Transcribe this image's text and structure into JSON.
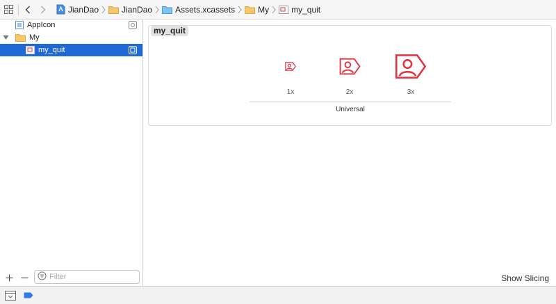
{
  "jumpbar": {
    "crumbs": [
      {
        "label": "JianDao",
        "icon": "project-file-icon"
      },
      {
        "label": "JianDao",
        "icon": "folder-icon"
      },
      {
        "label": "Assets.xcassets",
        "icon": "asset-catalog-icon"
      },
      {
        "label": "My",
        "icon": "folder-icon"
      },
      {
        "label": "my_quit",
        "icon": "image-set-icon"
      }
    ]
  },
  "sidebar": {
    "items": [
      {
        "label": "AppIcon",
        "icon": "appicon-icon"
      },
      {
        "label": "My",
        "icon": "folder-icon"
      },
      {
        "label": "my_quit",
        "icon": "image-set-icon"
      }
    ],
    "filter_placeholder": "Filter"
  },
  "editor": {
    "set_name": "my_quit",
    "slots": [
      {
        "scale": "1x"
      },
      {
        "scale": "2x"
      },
      {
        "scale": "3x"
      }
    ],
    "idiom": "Universal",
    "show_slicing": "Show Slicing"
  },
  "colors": {
    "selection": "#1f68d8",
    "icon_red": "#e5303e",
    "folder": "#f5c96b",
    "catalog_blue": "#5aa9e6"
  }
}
